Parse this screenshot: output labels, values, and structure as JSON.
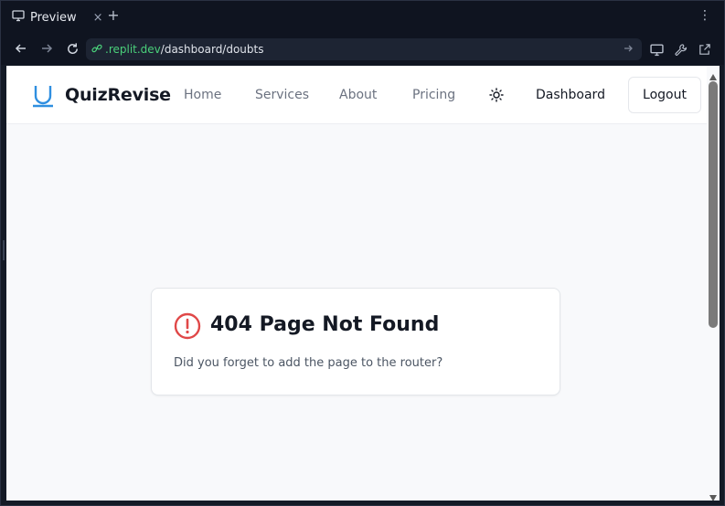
{
  "browser": {
    "tab": {
      "title": "Preview",
      "close_glyph": "×",
      "icon": "monitor-icon"
    },
    "new_tab_glyph": "+",
    "menu_glyph": "⋮",
    "address": {
      "domain": ".replit.dev",
      "path": "/dashboard/doubts"
    },
    "colors": {
      "chrome_bg": "#0f1420",
      "url_bar_bg": "#1d2433",
      "domain_green": "#4ad07a"
    }
  },
  "site": {
    "brand": "QuizRevise",
    "nav": {
      "home": "Home",
      "services": "Services",
      "about": "About",
      "pricing": "Pricing"
    },
    "dashboard_label": "Dashboard",
    "logout_label": "Logout",
    "accent_color": "#2f8fe0"
  },
  "error_card": {
    "title": "404 Page Not Found",
    "message": "Did you forget to add the page to the router?",
    "icon": "alert-circle-icon",
    "icon_color": "#e04848"
  }
}
